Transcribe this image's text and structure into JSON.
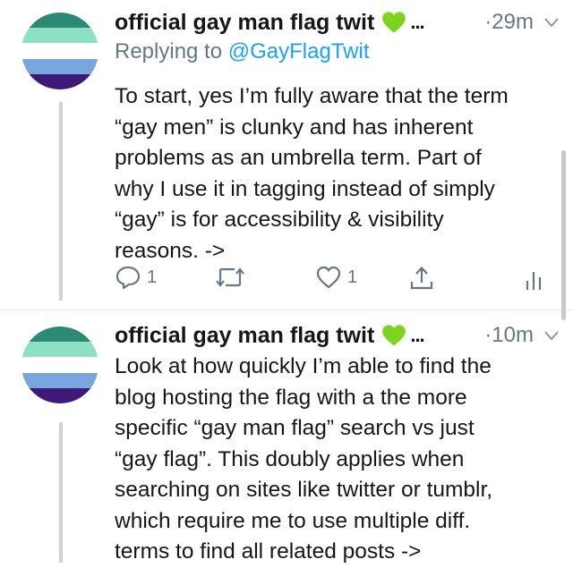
{
  "colors": {
    "text": "#14171a",
    "muted": "#657786",
    "link": "#1da1f2",
    "heart_green": "#7ed321",
    "flag_stripes": [
      "#2a8a73",
      "#8ee0c4",
      "#ffffff",
      "#7aa6e0",
      "#3d1a78"
    ]
  },
  "tweets": [
    {
      "display_name": "official gay man flag twit",
      "name_icon": "green-heart-icon",
      "truncation": "...",
      "time": "·29m",
      "replying_prefix": "Replying to",
      "replying_handle": "@GayFlagTwit",
      "text": "To start, yes I’m fully aware that the term\n“gay men” is clunky and has inherent\nproblems as an umbrella term. Part of\nwhy  I use it in tagging instead of simply\n“gay” is for accessibility & visibility\nreasons. ->",
      "actions": {
        "reply_count": "1",
        "retweet_count": "",
        "like_count": "1"
      }
    },
    {
      "display_name": "official gay man flag twit",
      "name_icon": "green-heart-icon",
      "truncation": "...",
      "time": "·10m",
      "text": "Look at how quickly I’m able to find the\nblog hosting the flag with a the more\nspecific “gay man flag” search vs just\n“gay flag”. This doubly applies when\nsearching on sites like twitter or tumblr,\nwhich require me to use multiple diff.\nterms to find all related posts ->"
    }
  ]
}
